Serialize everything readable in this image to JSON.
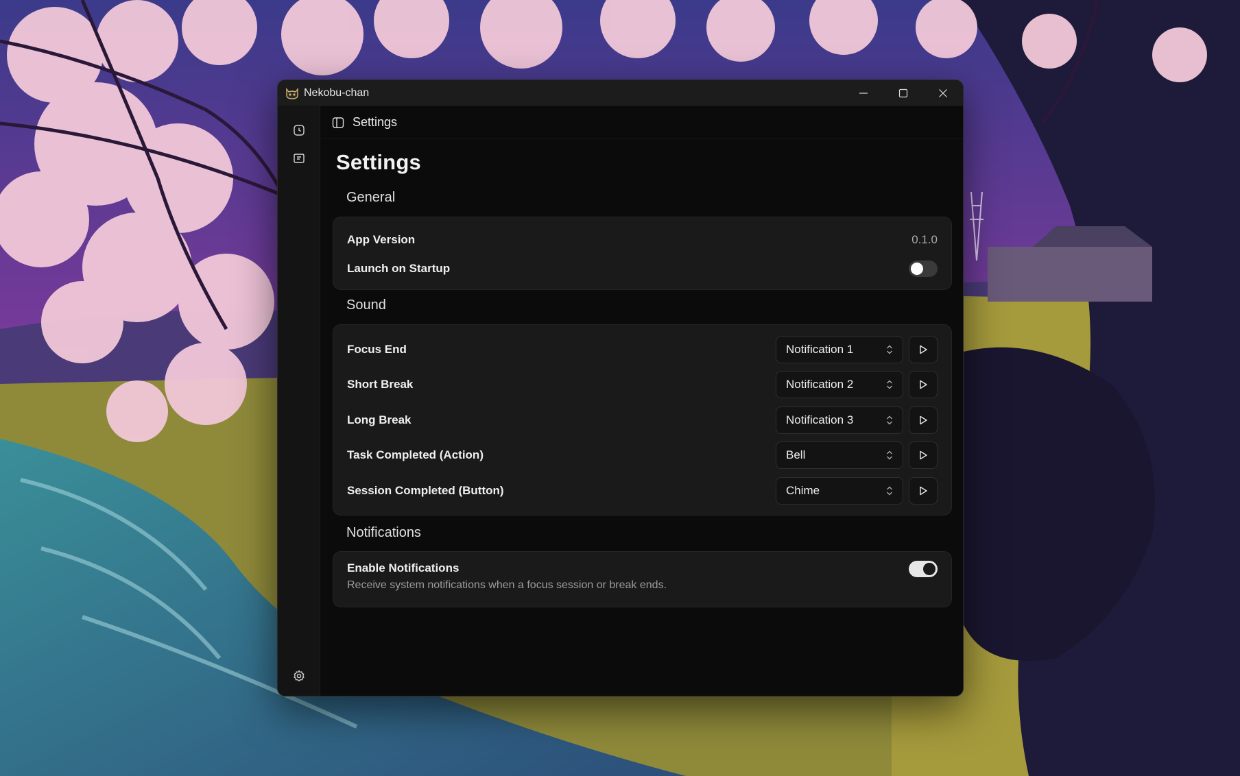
{
  "window": {
    "title": "Nekobu-chan",
    "controls": [
      "minimize-icon",
      "maximize-icon",
      "close-icon"
    ]
  },
  "rail": {
    "items": [
      {
        "icon": "timer-icon"
      },
      {
        "icon": "tasks-icon"
      }
    ],
    "bottom": {
      "icon": "gear-icon"
    }
  },
  "topbar": {
    "icon": "sidebar-toggle-icon",
    "breadcrumb": "Settings"
  },
  "page": {
    "title": "Settings"
  },
  "general": {
    "title": "General",
    "app_version_label": "App Version",
    "app_version_value": "0.1.0",
    "launch_on_startup_label": "Launch on Startup",
    "launch_on_startup_enabled": false
  },
  "sound": {
    "title": "Sound",
    "rows": [
      {
        "label": "Focus End",
        "value": "Notification 1"
      },
      {
        "label": "Short Break",
        "value": "Notification 2"
      },
      {
        "label": "Long Break",
        "value": "Notification 3"
      },
      {
        "label": "Task Completed (Action)",
        "value": "Bell"
      },
      {
        "label": "Session Completed (Button)",
        "value": "Chime"
      }
    ]
  },
  "notifications": {
    "title": "Notifications",
    "enable_label": "Enable Notifications",
    "enable_description": "Receive system notifications when a focus session or break ends.",
    "enabled": true
  },
  "colors": {
    "window_bg": "#0b0b0b",
    "card_bg": "#1a1a1a",
    "titlebar_bg": "#1c1c1c"
  }
}
